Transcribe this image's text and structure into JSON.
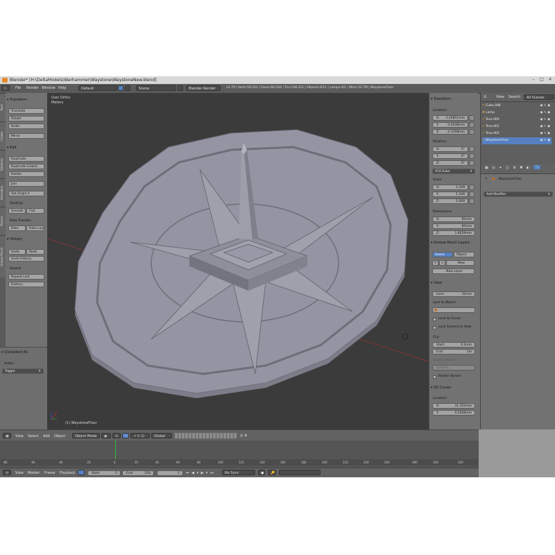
{
  "window": {
    "title": "Blender* [H:\\DeltaModels\\Warhammer\\Waystone\\WaystoneNew.blend]"
  },
  "infobar": {
    "menus": [
      "File",
      "Render",
      "Window",
      "Help"
    ],
    "layout": "Default",
    "scene": "Scene",
    "engine": "Blender Render",
    "stats": "v2.79 | Verts:59,222 | Faces:60,544 | Tris:108,252 | Objects:0/11 | Lamps:0/1 | Mem:33.7M | WaystoneFloor"
  },
  "tool_tabs": [
    "Tools",
    "Create",
    "Relations",
    "Animation",
    "Physics",
    "Grease Pencil"
  ],
  "toolshelf": {
    "transform_header": "Transform",
    "translate": "Translate",
    "rotate": "Rotate",
    "scale": "Scale",
    "mirror": "Mirror",
    "edit_header": "Edit",
    "duplicate": "Duplicate",
    "duplicate_linked": "Duplicate Linked",
    "delete": "Delete",
    "join": "Join",
    "set_origin": "Set Origin",
    "shading_label": "Shading:",
    "smooth": "Smooth",
    "flat": "Flat",
    "data_transfer_label": "Data Transfer:",
    "data": "Data",
    "data_layout": "Data Layo",
    "history_header": "History",
    "undo": "Undo",
    "redo": "Redo",
    "undo_history": "Undo History",
    "repeat_label": "Repeat:",
    "repeat_last": "Repeat Last",
    "history_btn": "History...",
    "op_header": "(De)select All",
    "action_label": "Action",
    "action_value": "Toggle"
  },
  "viewport": {
    "view_name": "User Ortho",
    "units": "Meters",
    "object_label": "(1) WaystoneFloor"
  },
  "npanel": {
    "transform_header": "Transform",
    "location_label": "Location:",
    "location": [
      {
        "axis": "X:",
        "value": "1.20851mm"
      },
      {
        "axis": "Y:",
        "value": "-3.4438mm"
      },
      {
        "axis": "Z:",
        "value": "-2.3308mm"
      }
    ],
    "rotation_label": "Rotation:",
    "rotation": [
      {
        "axis": "X:",
        "value": "0°"
      },
      {
        "axis": "Y:",
        "value": "0°"
      },
      {
        "axis": "Z:",
        "value": "0°"
      }
    ],
    "rotation_mode": "XYZ Euler",
    "scale_label": "Scale:",
    "scale": [
      {
        "axis": "X:",
        "value": "1.549"
      },
      {
        "axis": "Y:",
        "value": "1.549"
      },
      {
        "axis": "Z:",
        "value": "1.000"
      }
    ],
    "dimensions_label": "Dimensions:",
    "dimensions": [
      {
        "axis": "X:",
        "value": "85mm"
      },
      {
        "axis": "Y:",
        "value": "85mm"
      },
      {
        "axis": "Z:",
        "value": "1.8259mm"
      }
    ],
    "grease_pencil_header": "Grease Pencil Layers",
    "scene_tab": "Scene",
    "object_tab": "Object",
    "new_btn": "New",
    "new_layer_btn": "New Layer",
    "view_header": "View",
    "lens_label": "Lens:",
    "lens_value": "35mm",
    "lock_to_object_label": "Lock to Object:",
    "lock_to_cursor": "Lock to Cursor",
    "lock_camera": "Lock Camera to View",
    "clip_label": "Clip:",
    "clip_start_label": "Start:",
    "clip_start": "0.1mm",
    "clip_end_label": "End:",
    "clip_end": "1m",
    "local_camera_label": "Local Camera:",
    "camera_value": "Camera",
    "render_border": "Render Border",
    "cursor_header": "3D Cursor",
    "cursor_location_label": "Location:",
    "cursor_x_label": "X:",
    "cursor_x": "31.351mm",
    "cursor_y_label": "Y:",
    "cursor_y": "0.5448mm"
  },
  "outliner": {
    "tabs": [
      "View",
      "Search",
      "All Scenes"
    ],
    "items": [
      "Cube.008",
      "Lamp",
      "Tesa.000",
      "Tesa.001",
      "Tesa.002",
      "WaystoneFloor"
    ]
  },
  "properties": {
    "object_name": "WaystoneFloor",
    "add_modifier": "Add Modifier"
  },
  "view_header": {
    "menus": [
      "View",
      "Select",
      "Add",
      "Object"
    ],
    "mode": "Object Mode",
    "pivot": "Global"
  },
  "timeline": {
    "ticks": [
      "-80",
      "-60",
      "-40",
      "-20",
      "0",
      "20",
      "40",
      "60",
      "80",
      "100",
      "120",
      "140",
      "160",
      "180",
      "200",
      "220",
      "240",
      "260",
      "280",
      "300",
      "320"
    ],
    "menus": [
      "View",
      "Marker",
      "Frame",
      "Playback"
    ],
    "start_label": "Start:",
    "start_value": "1",
    "end_label": "End:",
    "end_value": "250",
    "current_frame": "1",
    "sync": "No Sync"
  },
  "colors": {
    "accent_blue": "#5680c2",
    "frame_green": "#2ebd3a",
    "mesh": "#8c8c9a",
    "viewport_bg": "#3b3b3b"
  }
}
